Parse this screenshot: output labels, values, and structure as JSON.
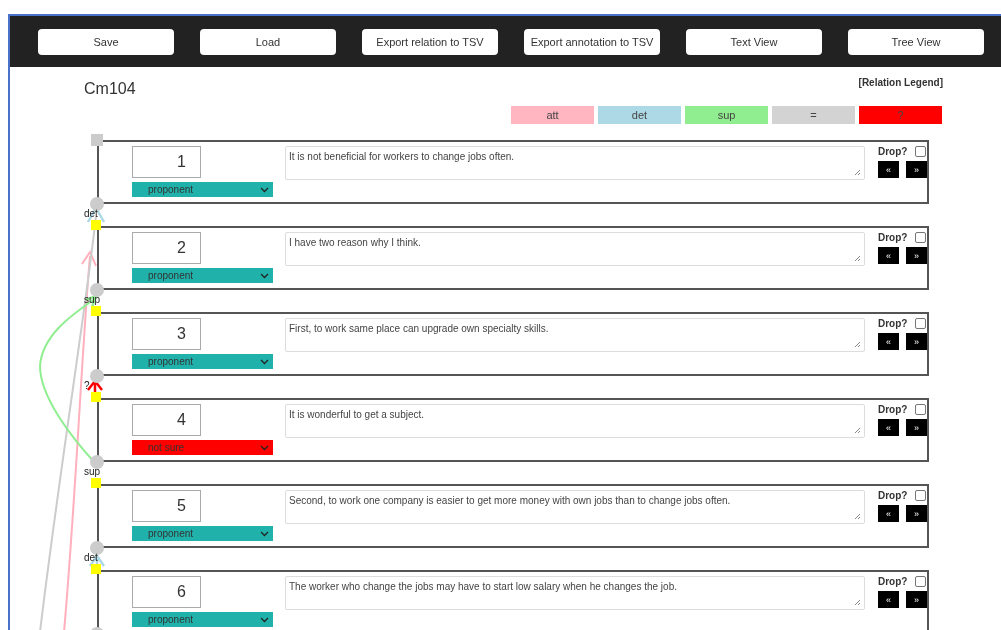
{
  "toolbar": {
    "buttons": [
      "Save",
      "Load",
      "Export relation to TSV",
      "Export annotation to TSV",
      "Text View",
      "Tree View"
    ]
  },
  "document": {
    "title": "Cm104"
  },
  "legend": {
    "title": "[Relation Legend]",
    "items": [
      {
        "label": "att",
        "color": "#ffb6c1"
      },
      {
        "label": "det",
        "color": "#add8e6"
      },
      {
        "label": "sup",
        "color": "#90ee90"
      },
      {
        "label": "=",
        "color": "#d3d3d3"
      },
      {
        "label": "?",
        "color": "#ff0000"
      }
    ]
  },
  "units": [
    {
      "number": "1",
      "text": "It is not beneficial for workers to change jobs often.",
      "stance": "proponent",
      "color": "#20b2aa",
      "drop_label": "Drop?",
      "dropped": false,
      "prev": "«",
      "next": "»"
    },
    {
      "number": "2",
      "relation": "det",
      "text": "I have two reason why I think.",
      "stance": "proponent",
      "color": "#20b2aa",
      "drop_label": "Drop?",
      "dropped": false,
      "prev": "«",
      "next": "»"
    },
    {
      "number": "3",
      "relation": "sup",
      "text": "First, to work same place can upgrade own specialty skills.",
      "stance": "proponent",
      "color": "#20b2aa",
      "drop_label": "Drop?",
      "dropped": false,
      "prev": "«",
      "next": "»"
    },
    {
      "number": "4",
      "relation": "?",
      "text": "It is wonderful to get a subject.",
      "stance": "not sure",
      "color": "#ff0000",
      "drop_label": "Drop?",
      "dropped": false,
      "prev": "«",
      "next": "»"
    },
    {
      "number": "5",
      "relation": "sup",
      "text": "Second, to work one company is easier to get more money with own jobs than to change jobs often.",
      "stance": "proponent",
      "color": "#20b2aa",
      "drop_label": "Drop?",
      "dropped": false,
      "prev": "«",
      "next": "»"
    },
    {
      "number": "6",
      "relation": "det",
      "text": "The worker who change the jobs may have to start low salary when he changes the job.",
      "stance": "proponent",
      "color": "#20b2aa",
      "drop_label": "Drop?",
      "dropped": false,
      "prev": "«",
      "next": "»"
    }
  ]
}
